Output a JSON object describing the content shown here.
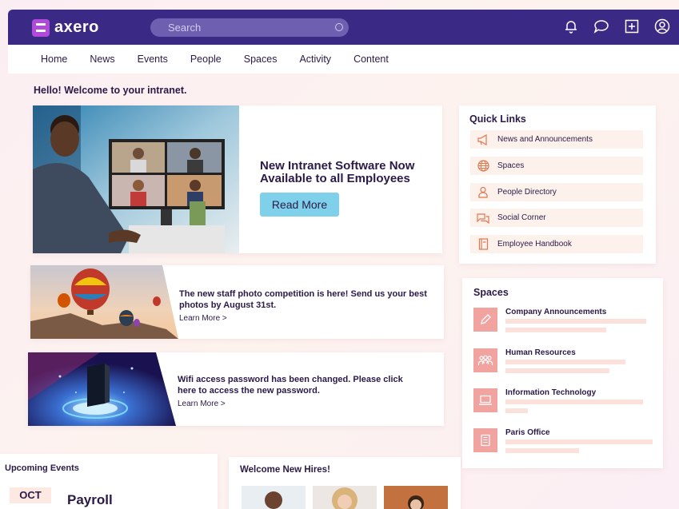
{
  "header": {
    "brand": "axero",
    "search_placeholder": "Search"
  },
  "nav": {
    "items": [
      "Home",
      "News",
      "Events",
      "People",
      "Spaces",
      "Activity",
      "Content"
    ]
  },
  "greeting": "Hello! Welcome to your intranet.",
  "hero": {
    "title": "New Intranet Software Now Available to all Employees",
    "button": "Read More"
  },
  "banners": [
    {
      "text": "The new staff photo competition is here! Send us your best photos by August 31st.",
      "link": "Learn More >"
    },
    {
      "text": "Wifi access password has been changed. Please click here to access the new password.",
      "link": "Learn More >"
    }
  ],
  "quick_links": {
    "title": "Quick Links",
    "items": [
      {
        "label": "News and Announcements",
        "icon": "megaphone-icon"
      },
      {
        "label": "Spaces",
        "icon": "globe-icon"
      },
      {
        "label": "People Directory",
        "icon": "person-icon"
      },
      {
        "label": "Social Corner",
        "icon": "chat-icon"
      },
      {
        "label": "Employee Handbook",
        "icon": "book-icon"
      }
    ]
  },
  "spaces": {
    "title": "Spaces",
    "items": [
      {
        "name": "Company Announcements",
        "icon": "pen-icon"
      },
      {
        "name": "Human Resources",
        "icon": "people-icon"
      },
      {
        "name": "Information Technology",
        "icon": "laptop-icon"
      },
      {
        "name": "Paris Office",
        "icon": "building-icon"
      }
    ]
  },
  "events": {
    "title": "Upcoming Events",
    "month": "OCT",
    "event": "Payroll"
  },
  "hires": {
    "title": "Welcome New Hires!"
  },
  "colors": {
    "header_bg": "#3a2a86",
    "accent": "#7fd0ea",
    "icon_accent": "#e0774f",
    "space_icon_bg": "#f1a3a0"
  }
}
